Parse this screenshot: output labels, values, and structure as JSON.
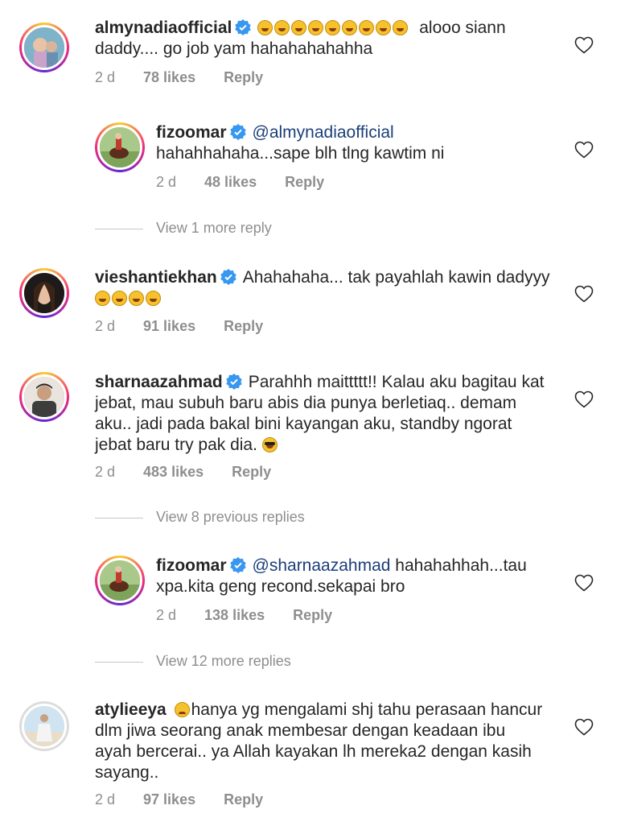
{
  "comments": [
    {
      "username": "almynadiaofficial",
      "verified": true,
      "emoji_prefix_count": 9,
      "text_line1": "alooo siann",
      "text_line2": "daddy.... go job yam hahahahahahha",
      "time": "2 d",
      "likes": "78 likes",
      "reply": "Reply"
    },
    {
      "username": "fizoomar",
      "verified": true,
      "mention": "@almynadiaofficial",
      "text_line2": "hahahhahaha...sape blh tlng kawtim ni",
      "time": "2 d",
      "likes": "48 likes",
      "reply": "Reply"
    },
    {
      "username": "vieshantiekhan",
      "verified": true,
      "text_line1": "Ahahahaha... tak payahlah kawin dadyyy",
      "emoji_line_count": 4,
      "time": "2 d",
      "likes": "91 likes",
      "reply": "Reply"
    },
    {
      "username": "sharnaazahmad",
      "verified": true,
      "text_line1": "Parahhh maittttt!! Kalau aku bagitau kat",
      "text_line2": "jebat, mau subuh baru abis dia punya berletiaq.. demam",
      "text_line3": "aku.. jadi pada bakal bini kayangan aku, standby ngorat",
      "text_line4": "jebat baru try pak dia.",
      "time": "2 d",
      "likes": "483 likes",
      "reply": "Reply"
    },
    {
      "username": "fizoomar",
      "verified": true,
      "mention": "@sharnaazahmad",
      "text_line1": "hahahahhah...tau",
      "text_line2": "xpa.kita geng recond.sekapai bro",
      "time": "2 d",
      "likes": "138 likes",
      "reply": "Reply"
    },
    {
      "username": "atylieeya",
      "verified": false,
      "text_line1": "hanya yg mengalami shj tahu perasaan hancur",
      "text_line2": "dlm jiwa seorang anak membesar dengan keadaan ibu",
      "text_line3": "ayah bercerai.. ya Allah kayakan lh mereka2 dengan kasih",
      "text_line4": "sayang..",
      "time": "2 d",
      "likes": "97 likes",
      "reply": "Reply"
    }
  ],
  "view_links": {
    "view1": "View 1 more reply",
    "view8": "View 8 previous replies",
    "view12": "View 12 more replies"
  },
  "icons": {
    "verified": "verified-badge-icon",
    "like": "heart-icon"
  },
  "colors": {
    "verified_blue": "#3897f0",
    "mention": "#1b3f7a",
    "meta_gray": "#8e8e8e"
  }
}
